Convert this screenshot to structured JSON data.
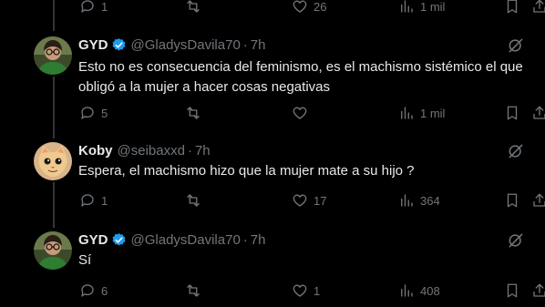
{
  "top_actions": {
    "replies": "1",
    "reposts": "",
    "likes": "26",
    "views": "1 mil"
  },
  "tweets": [
    {
      "name": "GYD",
      "verified": true,
      "handle": "@GladysDavila70",
      "time": "7h",
      "text": "Esto no es consecuencia del feminismo, es el machismo sistémico el que obligó a la mujer a hacer cosas negativas",
      "replies": "5",
      "reposts": "",
      "likes": "",
      "views": "1 mil"
    },
    {
      "name": "Koby",
      "verified": false,
      "handle": "@seibaxxd",
      "time": "7h",
      "text": "Espera, el machismo hizo que la mujer mate a su hijo ?",
      "replies": "1",
      "reposts": "",
      "likes": "17",
      "views": "364"
    },
    {
      "name": "GYD",
      "verified": true,
      "handle": "@GladysDavila70",
      "time": "7h",
      "text": "Sí",
      "replies": "6",
      "reposts": "",
      "likes": "1",
      "views": "408"
    }
  ],
  "dot_separator": "·",
  "more_glyph": "···",
  "colors": {
    "background": "#000000",
    "text": "#e7e9ea",
    "muted": "#71767b",
    "verified": "#1d9bf0",
    "thread_line": "#333639"
  },
  "icons": [
    "reply-icon",
    "repost-icon",
    "like-icon",
    "views-icon",
    "bookmark-icon",
    "share-icon",
    "grok-icon",
    "verified-badge-icon"
  ]
}
